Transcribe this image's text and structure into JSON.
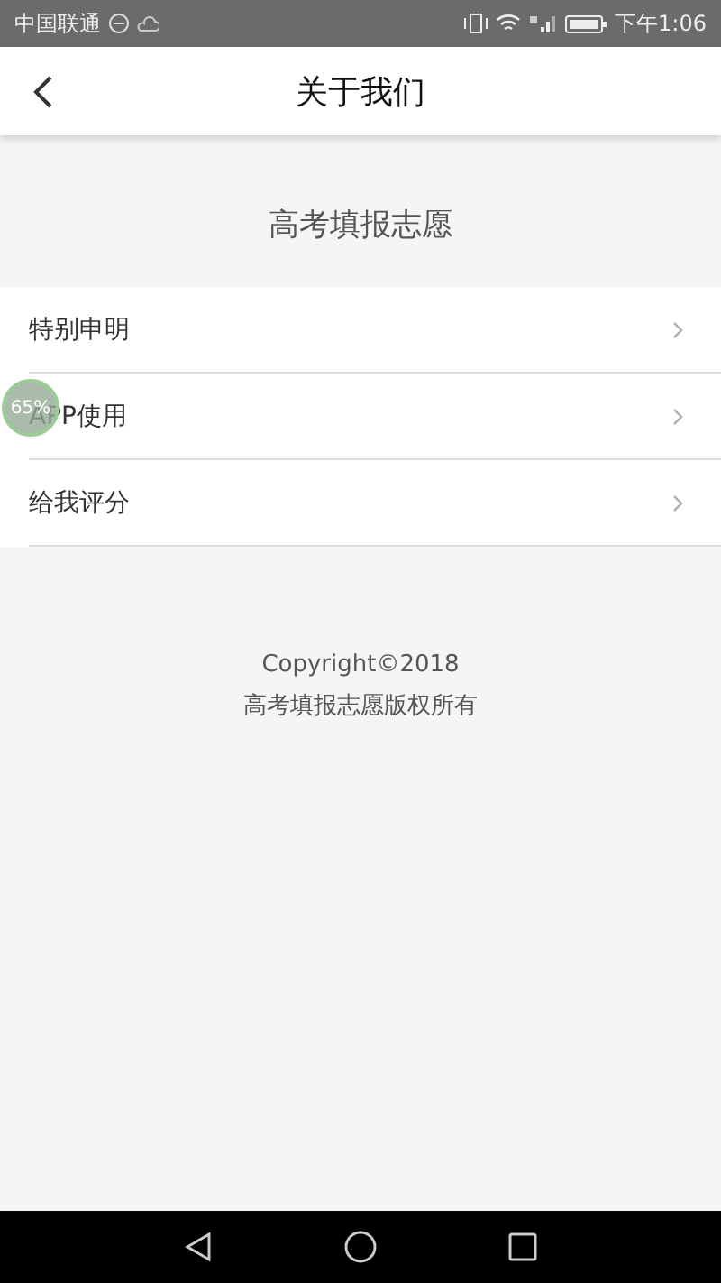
{
  "status_bar": {
    "carrier": "中国联通",
    "time": "下午1:06"
  },
  "header": {
    "title": "关于我们"
  },
  "app_name": "高考填报志愿",
  "menu": [
    {
      "label": "特别申明"
    },
    {
      "label": "APP使用"
    },
    {
      "label": "给我评分"
    }
  ],
  "floating_badge": {
    "text": "65%"
  },
  "footer": {
    "copyright": "Copyright©2018",
    "rights": "高考填报志愿版权所有"
  }
}
